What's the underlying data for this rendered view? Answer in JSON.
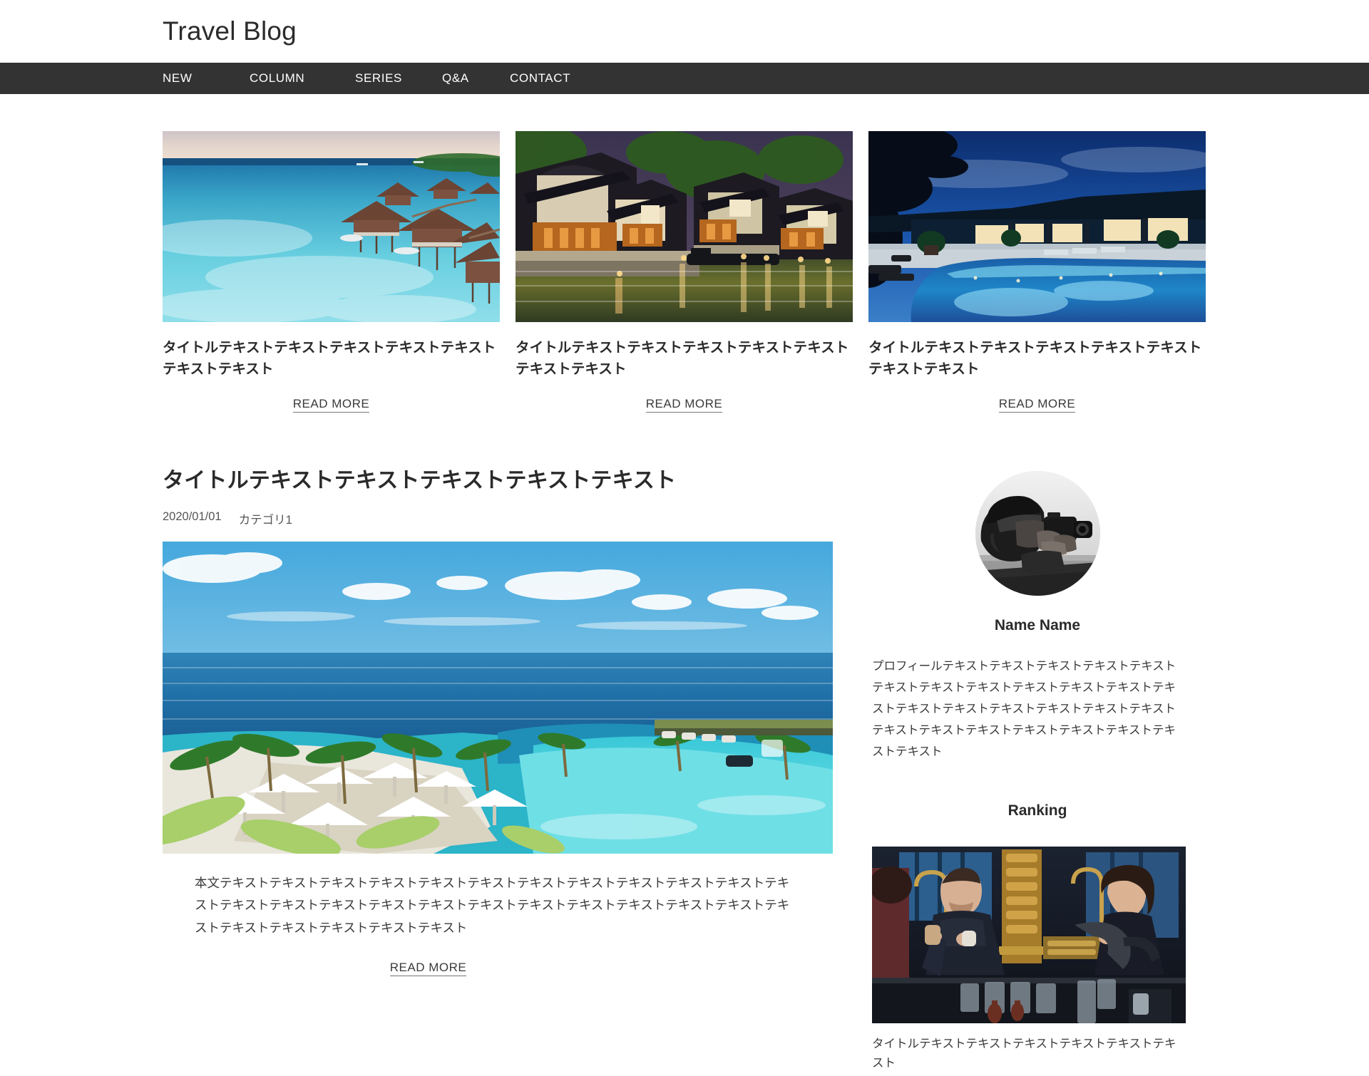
{
  "header": {
    "site_title": "Travel Blog"
  },
  "nav": {
    "items": [
      {
        "label": "NEW"
      },
      {
        "label": "COLUMN"
      },
      {
        "label": "SERIES"
      },
      {
        "label": "Q&A"
      },
      {
        "label": "CONTACT"
      }
    ]
  },
  "cards": [
    {
      "title": "タイトルテキストテキストテキストテキストテキストテキストテキスト",
      "read_more": "READ MORE",
      "image_name": "overwater-bungalows-maldives-photo"
    },
    {
      "title": "タイトルテキストテキストテキストテキストテキストテキストテキスト",
      "read_more": "READ MORE",
      "image_name": "chinese-water-town-night-photo"
    },
    {
      "title": "タイトルテキストテキストテキストテキストテキストテキストテキスト",
      "read_more": "READ MORE",
      "image_name": "resort-pool-twilight-photo"
    }
  ],
  "article": {
    "title": "タイトルテキストテキストテキストテキストテキスト",
    "date": "2020/01/01",
    "category": "カテゴリ1",
    "image_name": "tropical-resort-infinity-pool-photo",
    "body": "本文テキストテキストテキストテキストテキストテキストテキストテキストテキストテキストテキストテキストテキストテキストテキストテキストテキストテキストテキストテキストテキストテキストテキストテキストテキストテキストテキストテキストテキスト",
    "read_more": "READ MORE"
  },
  "sidebar": {
    "profile": {
      "avatar_name": "photographer-with-camera-portrait",
      "name": "Name Name",
      "text": "プロフィールテキストテキストテキストテキストテキストテキストテキストテキストテキストテキストテキストテキストテキストテキストテキストテキストテキストテキストテキストテキストテキストテキストテキストテキストテキストテキスト"
    },
    "ranking": {
      "heading": "Ranking",
      "items": [
        {
          "image_name": "coffee-bar-baristas-photo",
          "title": "タイトルテキストテキストテキストテキストテキストテキスト"
        }
      ]
    }
  },
  "colors": {
    "nav_background": "#333333",
    "text": "#333333",
    "page_background": "#ffffff"
  }
}
